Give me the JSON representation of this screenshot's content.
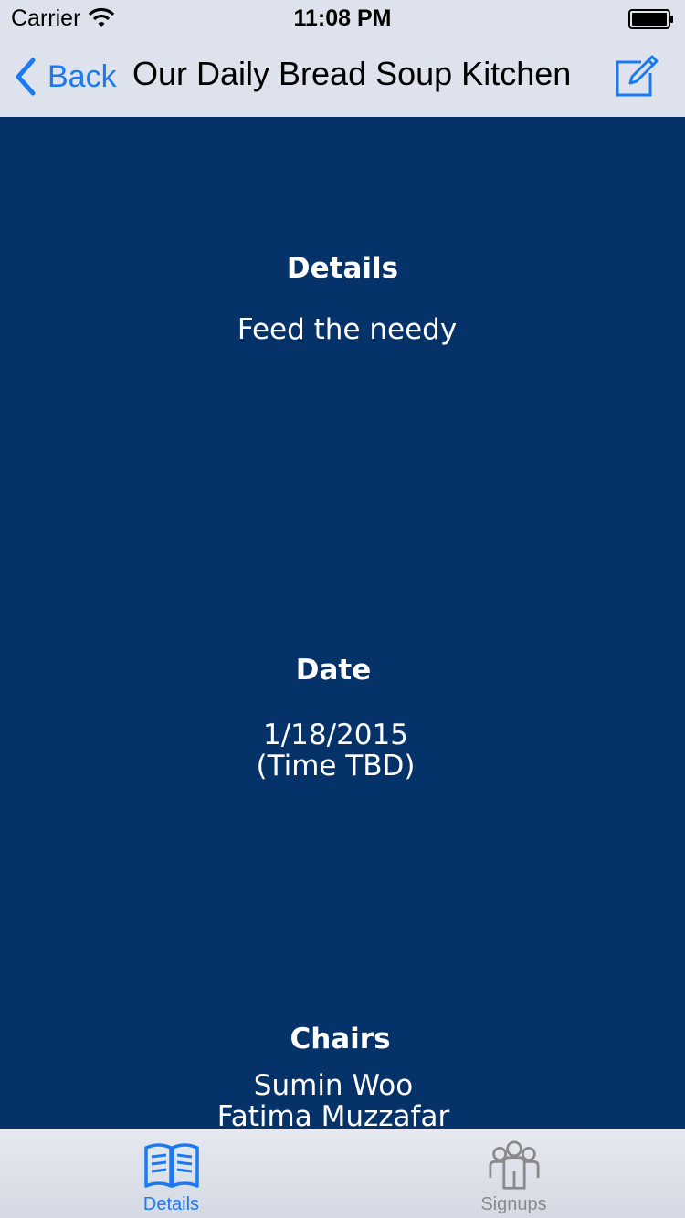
{
  "status_bar": {
    "carrier": "Carrier",
    "time": "11:08 PM"
  },
  "nav": {
    "back_label": "Back",
    "title": "Our Daily Bread Soup Kitchen",
    "right_icon": "compose-icon"
  },
  "details": {
    "heading": "Details",
    "text": "Feed the needy"
  },
  "date": {
    "heading": "Date",
    "line1": "1/18/2015",
    "line2": "(Time TBD)"
  },
  "chairs": {
    "heading": "Chairs",
    "names": [
      "Sumin Woo",
      "Fatima Muzzafar"
    ]
  },
  "tabs": [
    {
      "label": "Details",
      "icon": "book-icon",
      "selected": true
    },
    {
      "label": "Signups",
      "icon": "people-icon",
      "selected": false
    }
  ],
  "colors": {
    "accent": "#1a7af4",
    "background": "#06326a",
    "bar": "#dde2ec",
    "tab_inactive": "#8a8a8a"
  }
}
